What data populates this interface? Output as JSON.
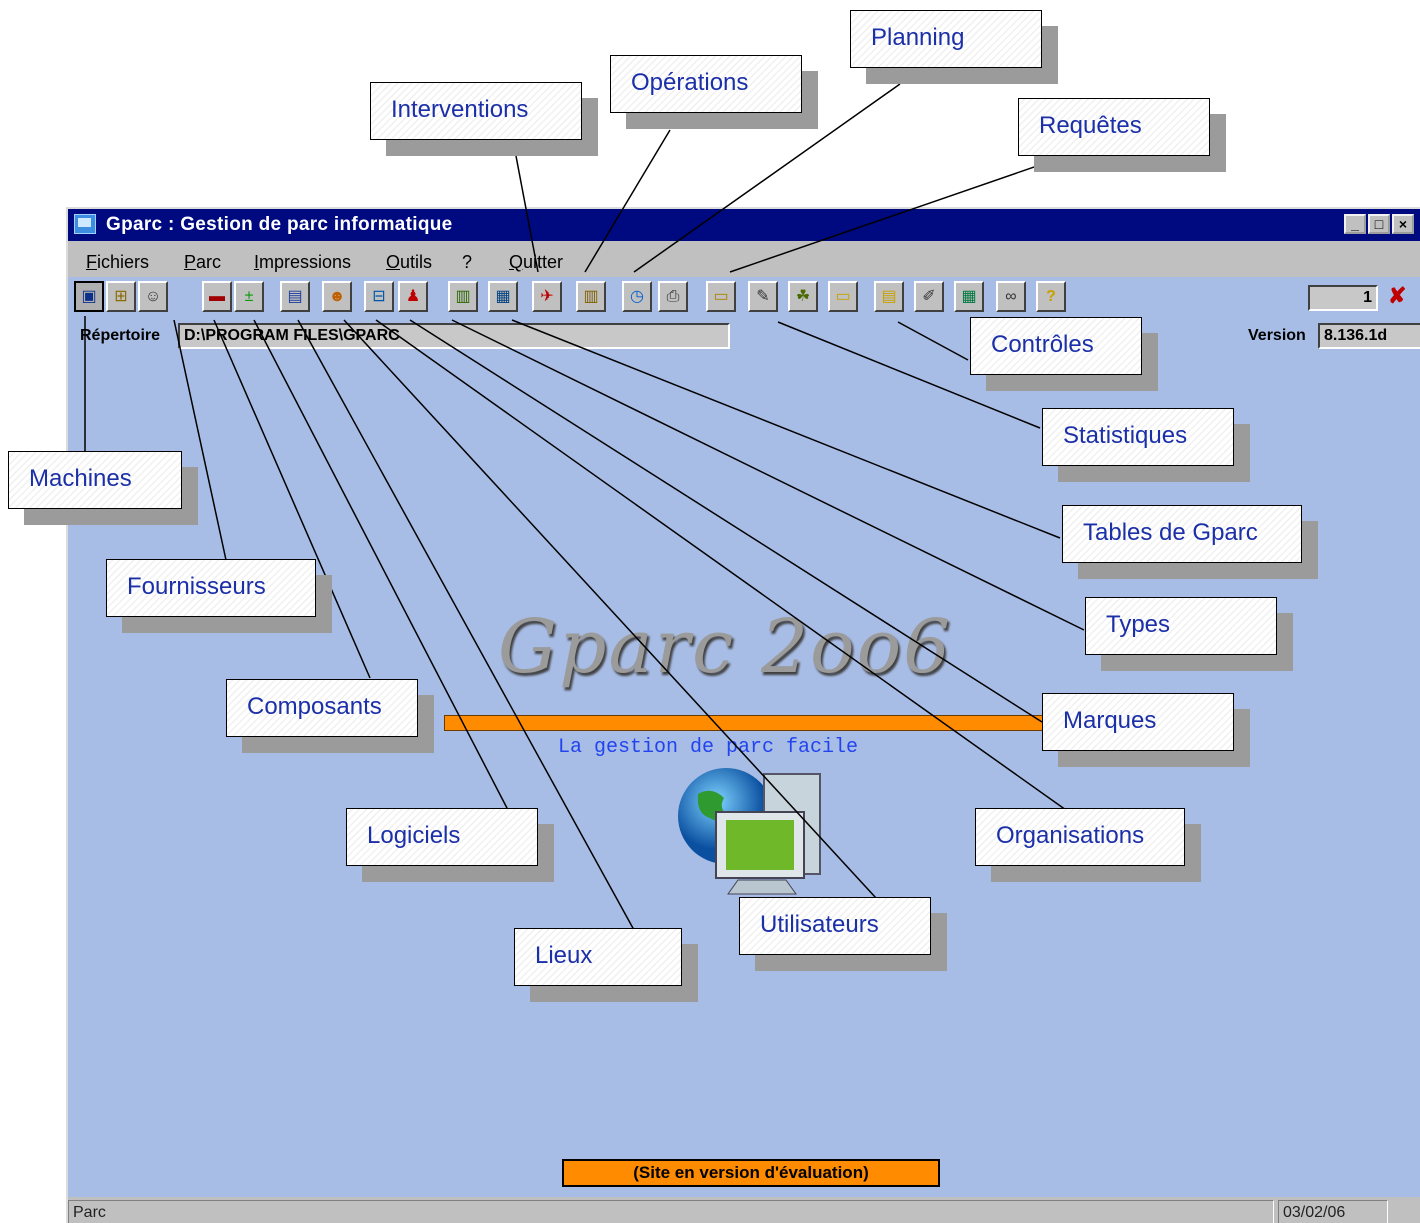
{
  "window": {
    "title": "Gparc : Gestion de parc informatique",
    "controls": [
      "minimize",
      "maximize",
      "close"
    ]
  },
  "menu": [
    "Fichiers",
    "Parc",
    "Impressions",
    "Outils",
    "?",
    "Quitter"
  ],
  "toolbar_icons": [
    "machine-icon",
    "tree-icon",
    "supplier-icon",
    "memory-chip-icon",
    "plus-minus-icon",
    "software-icon",
    "location-icon",
    "hierarchy-icon",
    "user-icon",
    "buildings-icon",
    "table-icon",
    "intervention-icon",
    "operation-icon",
    "clock-icon",
    "print-icon",
    "query-folder-icon",
    "statistics-icon",
    "controls-icon",
    "folder-icon",
    "book-icon",
    "eyedropper-icon",
    "calculator-icon",
    "binoculars-icon",
    "help-icon"
  ],
  "counter": {
    "value": "1"
  },
  "directory": {
    "label": "Répertoire",
    "value": "D:\\PROGRAM FILES\\GPARC"
  },
  "version": {
    "label": "Version",
    "value": "8.136.1d"
  },
  "splash": {
    "logo": "Gparc 2oo6",
    "tagline": "La gestion de parc facile"
  },
  "eval_banner": "(Site en version d'évaluation)",
  "status": {
    "left": "Parc",
    "date": "03/02/06"
  },
  "callouts": {
    "planning": "Planning",
    "operations": "Opérations",
    "interventions": "Interventions",
    "requetes": "Requêtes",
    "controles": "Contrôles",
    "statistiques": "Statistiques",
    "machines": "Machines",
    "tables": "Tables de Gparc",
    "fournisseurs": "Fournisseurs",
    "types": "Types",
    "composants": "Composants",
    "marques": "Marques",
    "logiciels": "Logiciels",
    "organisations": "Organisations",
    "utilisateurs": "Utilisateurs",
    "lieux": "Lieux"
  },
  "colors": {
    "title_bar": "#000a80",
    "desktop": "#a8bde6",
    "accent": "#ff8c00",
    "callout_text": "#1b2fa8"
  }
}
